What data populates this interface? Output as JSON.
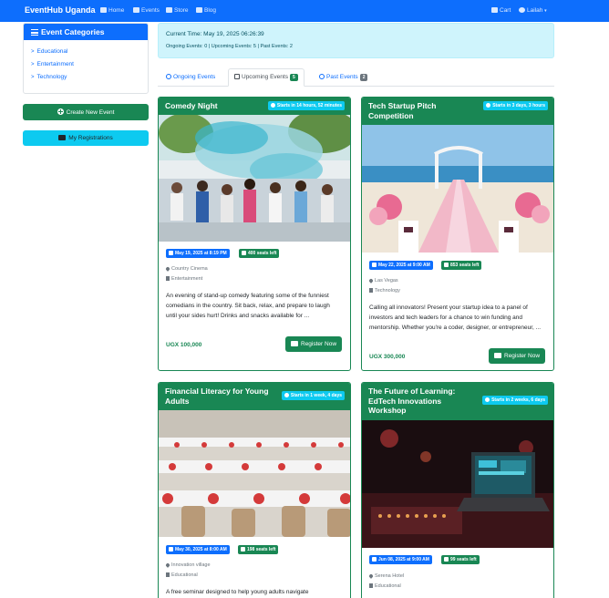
{
  "navbar": {
    "brand": "EventHub Uganda",
    "links": [
      {
        "label": "Home",
        "icon": "home-icon"
      },
      {
        "label": "Events",
        "icon": "calendar-icon"
      },
      {
        "label": "Store",
        "icon": "store-icon"
      },
      {
        "label": "Blog",
        "icon": "blog-icon"
      }
    ],
    "cart": "Cart",
    "user": "Lailah"
  },
  "sidebar": {
    "title": "Event Categories",
    "categories": [
      "Educational",
      "Entertainment",
      "Technology"
    ],
    "create_button": "Create New Event",
    "registrations_button": "My Registrations"
  },
  "info": {
    "current_time": "Current Time: May 19, 2025 06:26:39",
    "counts": "Ongoing Events: 0 | Upcoming Events: 5 | Past Events: 2"
  },
  "tabs": [
    {
      "label": "Ongoing Events",
      "badge": ""
    },
    {
      "label": "Upcoming Events",
      "badge": "5"
    },
    {
      "label": "Past Events",
      "badge": "2"
    }
  ],
  "events": [
    {
      "title": "Comedy Night",
      "starts_in": "Starts in 14 hours, 52 minutes",
      "date": "May 19, 2025 at 8:19 PM",
      "seats": "400 seats left",
      "location": "Country Cinema",
      "category": "Entertainment",
      "description": "An evening of stand-up comedy featuring some of the funniest comedians in the country. Sit back, relax, and prepare to laugh until your sides hurt! Drinks and snacks available for ...",
      "price": "UGX 100,000",
      "button": "Register Now"
    },
    {
      "title": "Tech Startup Pitch Competition",
      "starts_in": "Starts in 3 days, 3 hours",
      "date": "May 22, 2025 at 9:00 AM",
      "seats": "853 seats left",
      "location": "Las Vegas",
      "category": "Technology",
      "description": "Calling all innovators! Present your startup idea to a panel of investors and tech leaders for a chance to win funding and mentorship. Whether you're a coder, designer, or entrepreneur, ...",
      "price": "UGX 300,000",
      "button": "Register Now"
    },
    {
      "title": "Financial Literacy for Young Adults",
      "starts_in": "Starts in 1 week, 4 days",
      "date": "May 30, 2025 at 8:00 AM",
      "seats": "198 seats left",
      "location": "Innovation village",
      "category": "Educational",
      "description": "A free seminar designed to help young adults navigate"
    },
    {
      "title": "The Future of Learning: EdTech Innovations Workshop",
      "starts_in": "Starts in 2 weeks, 6 days",
      "date": "Jun 08, 2025 at 9:00 AM",
      "seats": "99 seats left",
      "location": "Serena Hotel",
      "category": "Educational"
    }
  ],
  "colors": {
    "primary": "#0d6efd",
    "success": "#198754",
    "info": "#0dcaf0",
    "info_bg": "#cff4fc",
    "secondary": "#6c757d"
  }
}
